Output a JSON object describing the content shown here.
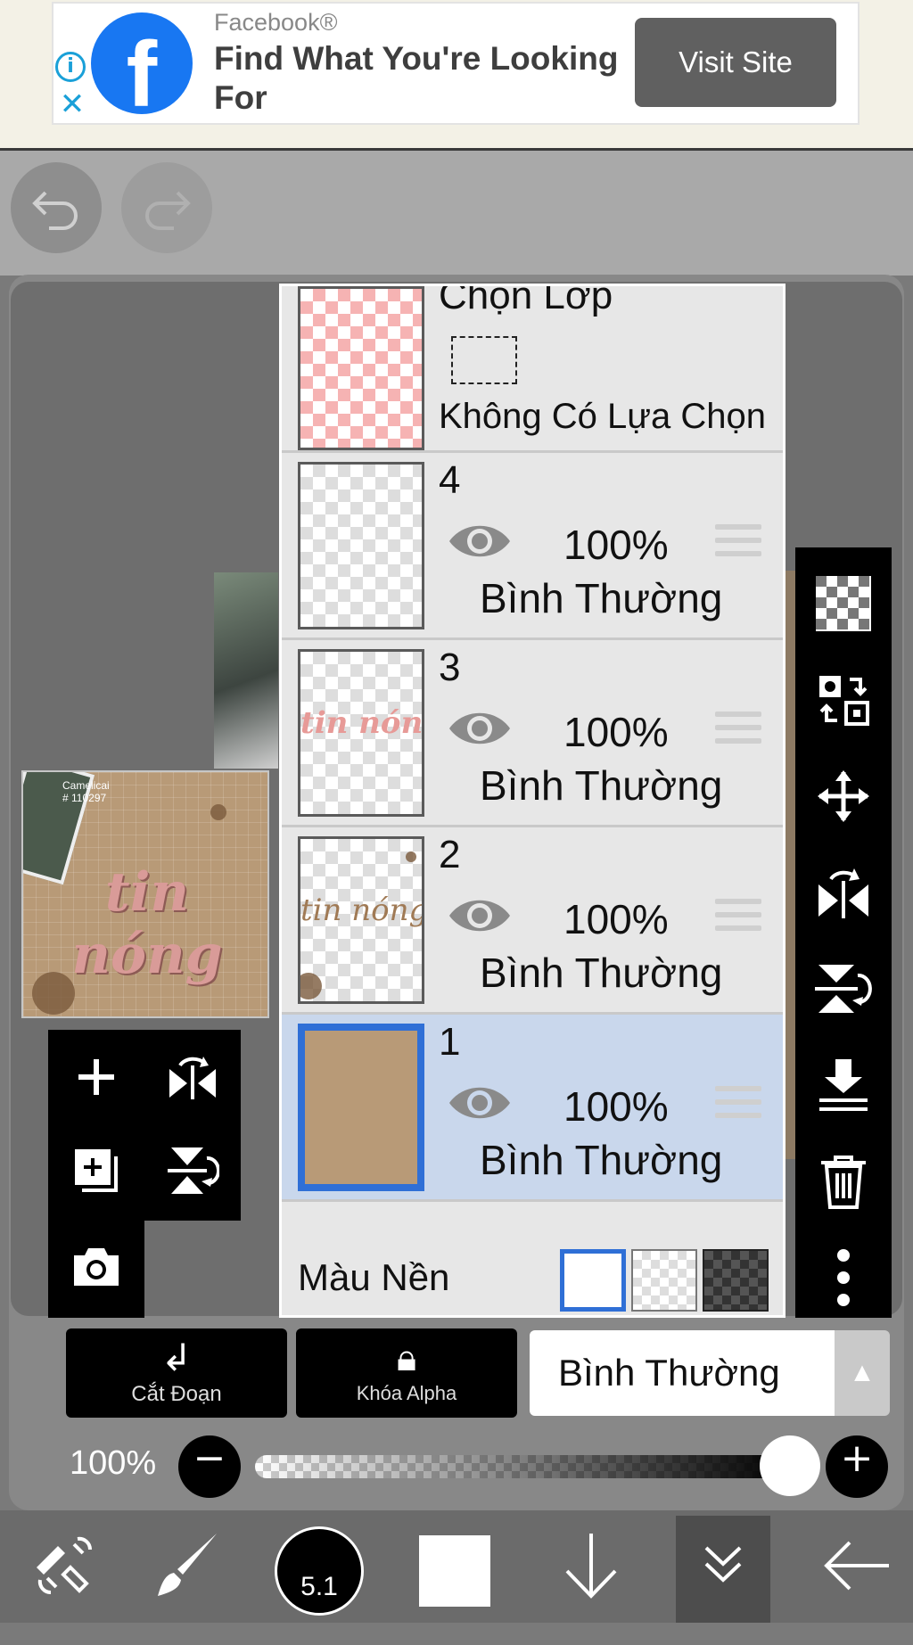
{
  "ad": {
    "brand": "Facebook®",
    "headline": "Find What You're Looking For",
    "cta": "Visit Site",
    "logo_glyph": "f",
    "info_glyph": "i",
    "close_glyph": "✕"
  },
  "preview": {
    "small_text": "Camelicai\n# 110297",
    "script_text": "tin nóng"
  },
  "selection_layer": {
    "title": "Chọn Lớp",
    "status": "Không Có Lựa Chọn"
  },
  "layers": [
    {
      "number": "4",
      "opacity": "100%",
      "blend": "Bình Thường",
      "thumb_text": "",
      "selected": false
    },
    {
      "number": "3",
      "opacity": "100%",
      "blend": "Bình Thường",
      "thumb_text": "tin nóng",
      "selected": false
    },
    {
      "number": "2",
      "opacity": "100%",
      "blend": "Bình Thường",
      "thumb_text": "tin nóng",
      "selected": false
    },
    {
      "number": "1",
      "opacity": "100%",
      "blend": "Bình Thường",
      "thumb_text": "",
      "selected": true
    }
  ],
  "background": {
    "label": "Màu Nền",
    "selected": "white"
  },
  "controls": {
    "clip_label": "Cắt Đoạn",
    "alpha_lock_label": "Khóa Alpha",
    "blend_mode": "Bình Thường",
    "opacity_text": "100%",
    "opacity_value": 1.0
  },
  "toolbar": {
    "brush_size": "5.1"
  },
  "colors": {
    "accent": "#2f6fd6",
    "selected_row": "#c9d7ec",
    "facebook": "#1877f2"
  },
  "icons": [
    "undo-icon",
    "redo-icon",
    "add-layer-icon",
    "flip-horizontal-icon",
    "add-copy-icon",
    "flip-vertical-icon",
    "camera-icon",
    "checker-icon",
    "transform-icon",
    "move-icon",
    "mirror-icon",
    "flip-icon",
    "merge-down-icon",
    "trash-icon",
    "more-icon",
    "tools-icon",
    "brush-icon",
    "arrow-down-icon",
    "layers-collapse-icon",
    "back-icon"
  ]
}
